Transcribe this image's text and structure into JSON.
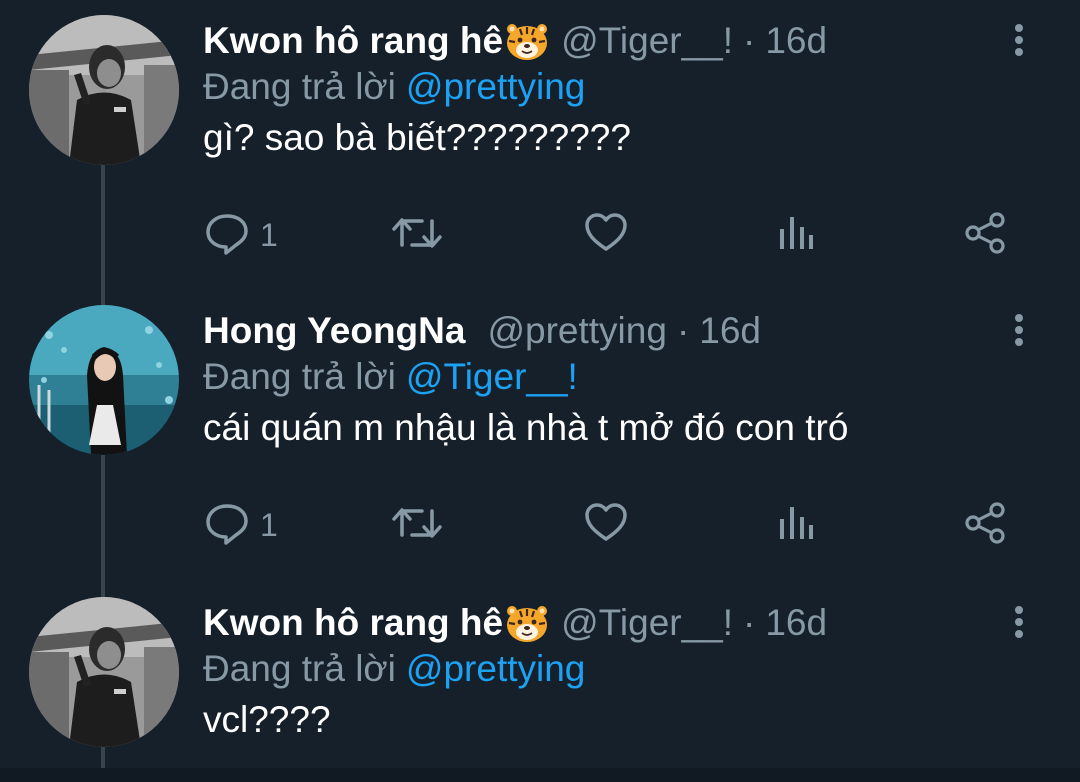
{
  "tweets": [
    {
      "name": "Kwon hô rang hê",
      "emoji": "tiger-face",
      "handle": "@Tiger__!",
      "separator": "·",
      "time": "16d",
      "replying_label": "Đang trả lời",
      "replying_to": "@prettying",
      "text": "gì? sao bà biết?????????",
      "reply_count": "1",
      "avatar": "monochrome-portrait"
    },
    {
      "name": "Hong YeongNa",
      "emoji": "",
      "handle": "@prettying",
      "separator": "·",
      "time": "16d",
      "replying_label": "Đang trả lời",
      "replying_to": "@Tiger__!",
      "text": "cái quán m nhậu là nhà t mở đó con tró",
      "reply_count": "1",
      "avatar": "aquarium-portrait"
    },
    {
      "name": "Kwon hô rang hê",
      "emoji": "tiger-face",
      "handle": "@Tiger__!",
      "separator": "·",
      "time": "16d",
      "replying_label": "Đang trả lời",
      "replying_to": "@prettying",
      "text": "vcl????",
      "avatar": "monochrome-portrait"
    }
  ],
  "colors": {
    "background": "#15202b",
    "muted": "#8899a6",
    "accent": "#1da1f2",
    "thread_line": "#38444d"
  },
  "icons": [
    "reply-icon",
    "retweet-icon",
    "like-icon",
    "analytics-icon",
    "share-icon",
    "more-icon"
  ]
}
